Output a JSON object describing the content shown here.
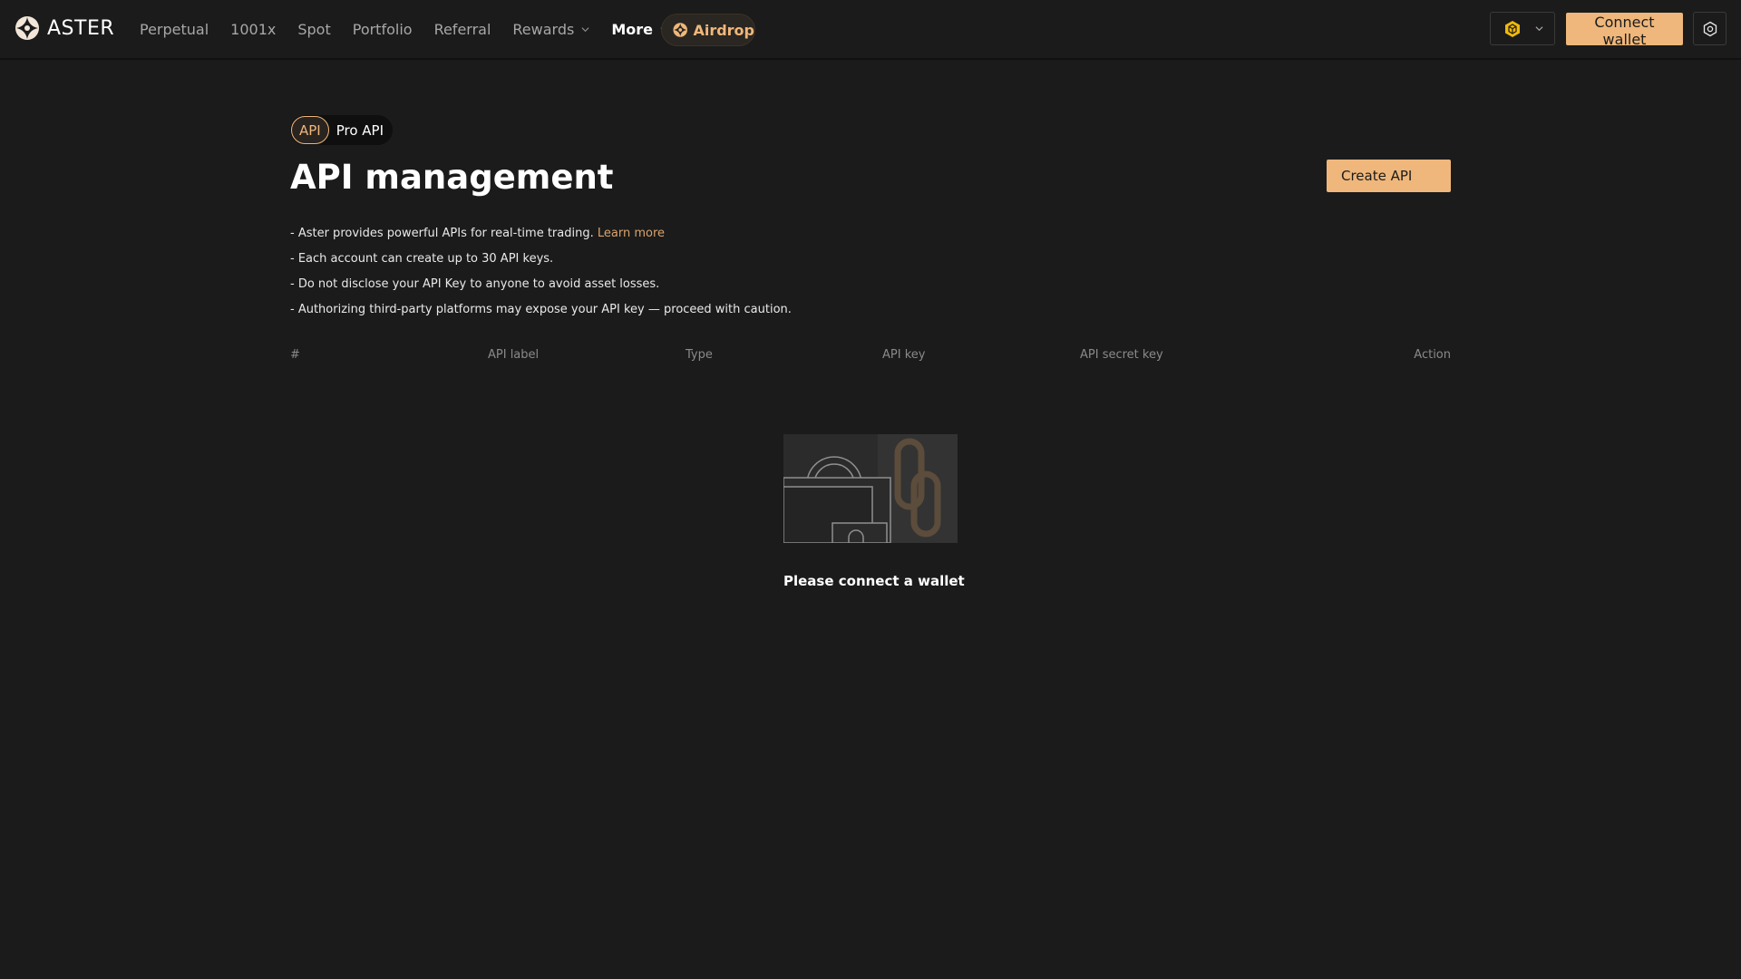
{
  "colors": {
    "background": "#1b1b1b",
    "accent": "#efb77b",
    "link": "#d9a36d",
    "muted_text": "#8a8a8a",
    "nav_text": "#a7a7a7"
  },
  "header": {
    "logo_text": "ASTER",
    "logo_icon": "aster-logo-icon",
    "nav": [
      {
        "label": "Perpetual"
      },
      {
        "label": "1001x"
      },
      {
        "label": "Spot"
      },
      {
        "label": "Portfolio"
      },
      {
        "label": "Referral"
      },
      {
        "label": "Rewards",
        "icon": "chevron-down-icon"
      },
      {
        "label": "More",
        "icon": "chevron-down-icon"
      }
    ],
    "airdrop_label": "Airdrop",
    "chain_icon": "bnb-chain-icon",
    "connect_wallet_label": "Connect wallet",
    "settings_icon": "gear-icon"
  },
  "main": {
    "tabs": [
      {
        "label": "API",
        "active": true
      },
      {
        "label": "Pro API",
        "active": false
      }
    ],
    "title": "API management",
    "create_button_label": "Create API",
    "notes": {
      "note1_text": "- Aster provides powerful APIs for real-time trading.",
      "note1_link": "Learn more",
      "note2": "- Each account can create up to 30 API keys.",
      "note3": "- Do not disclose your API Key to anyone to avoid asset losses.",
      "note4": "- Authorizing third-party platforms may expose your API key — proceed with caution."
    },
    "table": {
      "columns": [
        "#",
        "API label",
        "Type",
        "API key",
        "API secret key",
        "Action"
      ]
    },
    "empty_state": {
      "icon": "lock-chain-illustration",
      "message": "Please connect a wallet"
    }
  }
}
